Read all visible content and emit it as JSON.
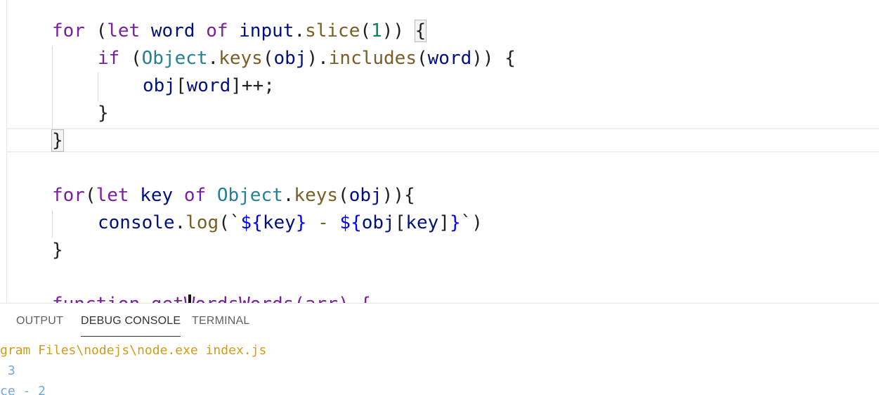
{
  "editor": {
    "lines": [
      {
        "segments": [
          {
            "t": "for",
            "c": "kw"
          },
          {
            "t": " (",
            "c": ""
          },
          {
            "t": "let",
            "c": "kw"
          },
          {
            "t": " ",
            "c": ""
          },
          {
            "t": "word",
            "c": "var"
          },
          {
            "t": " ",
            "c": ""
          },
          {
            "t": "of",
            "c": "kw"
          },
          {
            "t": " ",
            "c": ""
          },
          {
            "t": "input",
            "c": "var"
          },
          {
            "t": ".",
            "c": ""
          },
          {
            "t": "slice",
            "c": "fn"
          },
          {
            "t": "(",
            "c": ""
          },
          {
            "t": "1",
            "c": "num"
          },
          {
            "t": ")) ",
            "c": ""
          },
          {
            "t": "{",
            "c": "bracket"
          }
        ]
      },
      {
        "segments": [
          {
            "t": "if",
            "c": "kw"
          },
          {
            "t": " (",
            "c": ""
          },
          {
            "t": "Object",
            "c": "cls"
          },
          {
            "t": ".",
            "c": ""
          },
          {
            "t": "keys",
            "c": "fn"
          },
          {
            "t": "(",
            "c": ""
          },
          {
            "t": "obj",
            "c": "var"
          },
          {
            "t": ").",
            "c": ""
          },
          {
            "t": "includes",
            "c": "fn"
          },
          {
            "t": "(",
            "c": ""
          },
          {
            "t": "word",
            "c": "var"
          },
          {
            "t": ")) {",
            "c": ""
          }
        ]
      },
      {
        "segments": [
          {
            "t": "obj",
            "c": "var"
          },
          {
            "t": "[",
            "c": ""
          },
          {
            "t": "word",
            "c": "var"
          },
          {
            "t": "]++;",
            "c": ""
          }
        ]
      },
      {
        "segments": [
          {
            "t": "}",
            "c": ""
          }
        ]
      },
      {
        "segments": [
          {
            "t": "}",
            "c": "bracket"
          }
        ]
      },
      {
        "segments": [
          {
            "t": "for",
            "c": "kw"
          },
          {
            "t": "(",
            "c": ""
          },
          {
            "t": "let",
            "c": "kw"
          },
          {
            "t": " ",
            "c": ""
          },
          {
            "t": "key",
            "c": "var"
          },
          {
            "t": " ",
            "c": ""
          },
          {
            "t": "of",
            "c": "kw"
          },
          {
            "t": " ",
            "c": ""
          },
          {
            "t": "Object",
            "c": "cls"
          },
          {
            "t": ".",
            "c": ""
          },
          {
            "t": "keys",
            "c": "fn"
          },
          {
            "t": "(",
            "c": ""
          },
          {
            "t": "obj",
            "c": "var"
          },
          {
            "t": ")){",
            "c": ""
          }
        ]
      },
      {
        "segments": [
          {
            "t": "console",
            "c": "var"
          },
          {
            "t": ".",
            "c": ""
          },
          {
            "t": "log",
            "c": "fn"
          },
          {
            "t": "(`",
            "c": ""
          },
          {
            "t": "${",
            "c": "tpl"
          },
          {
            "t": "key",
            "c": "var"
          },
          {
            "t": "}",
            "c": "tpl"
          },
          {
            "t": " - ",
            "c": "fn"
          },
          {
            "t": "${",
            "c": "tpl"
          },
          {
            "t": "obj",
            "c": "var"
          },
          {
            "t": "[",
            "c": ""
          },
          {
            "t": "key",
            "c": "var"
          },
          {
            "t": "]",
            "c": ""
          },
          {
            "t": "}",
            "c": "tpl"
          },
          {
            "t": "`)",
            "c": ""
          }
        ]
      },
      {
        "segments": [
          {
            "t": "}",
            "c": ""
          }
        ]
      },
      {
        "segments": [
          {
            "t": "function getWordsWords(arr) {",
            "c": "kw"
          }
        ]
      }
    ]
  },
  "panel": {
    "tabs": [
      "OUTPUT",
      "DEBUG CONSOLE",
      "TERMINAL"
    ],
    "active_tab": "DEBUG CONSOLE",
    "console": [
      "gram Files\\nodejs\\node.exe index.js",
      " 3",
      "ce - 2"
    ]
  },
  "colors": {
    "keyword": "#7a1fa2",
    "class": "#267f99",
    "function": "#795e26",
    "number": "#098658",
    "variable": "#001080",
    "template": "#0000ff",
    "console_path": "#d39b19",
    "console_output": "#72a7d8"
  }
}
